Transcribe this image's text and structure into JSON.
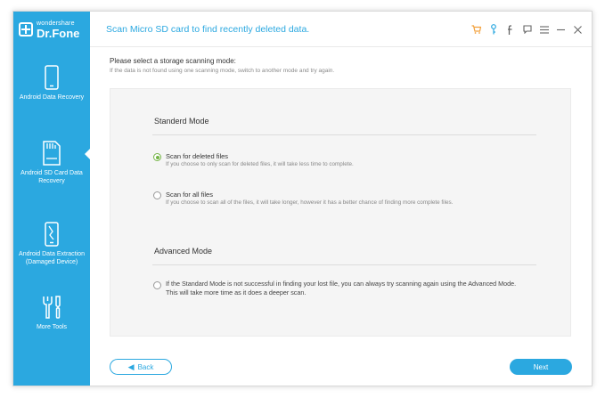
{
  "brand": {
    "small": "wondershare",
    "big": "Dr.Fone"
  },
  "header": {
    "title": "Scan Micro SD card to find recently deleted data."
  },
  "sidebar": {
    "items": [
      {
        "label": "Android Data Recovery",
        "icon": "phone-icon"
      },
      {
        "label": "Android SD Card Data Recovery",
        "icon": "sd-card-icon"
      },
      {
        "label": "Android Data Extraction (Damaged Device)",
        "icon": "broken-phone-icon"
      },
      {
        "label": "More Tools",
        "icon": "tools-icon"
      }
    ],
    "active_index": 1
  },
  "main": {
    "prompt": "Please select a storage scanning mode:",
    "hint": "If the data is not found using one scanning mode, switch to another mode and try again.",
    "standard": {
      "title": "Standerd Mode",
      "options": [
        {
          "title": "Scan for deleted files",
          "desc": "If you choose to only scan for deleted files, it will take less time to complete.",
          "selected": true
        },
        {
          "title": "Scan for all files",
          "desc": "If you choose to scan all of the files, it will take longer, however it has a better chance of finding more complete files.",
          "selected": false
        }
      ]
    },
    "advanced": {
      "title": "Advanced Mode",
      "text": "If the Standard Mode is not successful in finding your lost file, you can always try scanning again using the Advanced Mode. This will take more time as it does a deeper scan.",
      "selected": false
    }
  },
  "buttons": {
    "back": "Back",
    "next": "Next"
  },
  "colors": {
    "accent": "#2ba8e0",
    "cart": "#f2a13c",
    "radio_on": "#74b446"
  }
}
